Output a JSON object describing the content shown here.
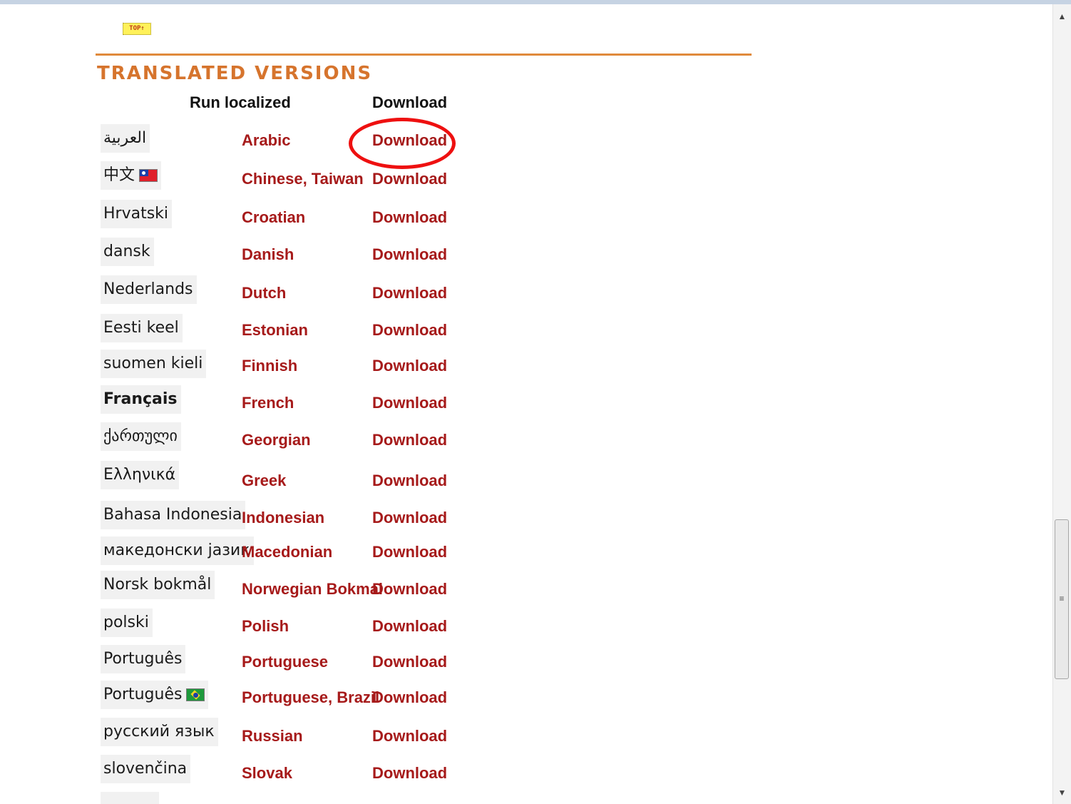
{
  "top_link": {
    "label": "TOP",
    "arrow": "↑"
  },
  "section": {
    "title": "TRANSLATED VERSIONS"
  },
  "headers": {
    "run_localized": "Run localized",
    "download": "Download"
  },
  "languages": [
    {
      "native": "العربية",
      "english": "Arabic",
      "download": "Download",
      "highlighted": true
    },
    {
      "native": "中文",
      "flag": "taiwan-flag-icon",
      "english": "Chinese, Taiwan",
      "download": "Download"
    },
    {
      "native": "Hrvatski",
      "english": "Croatian",
      "download": "Download"
    },
    {
      "native": "dansk",
      "english": "Danish",
      "download": "Download"
    },
    {
      "native": "Nederlands",
      "english": "Dutch",
      "download": "Download"
    },
    {
      "native": "Eesti keel",
      "english": "Estonian",
      "download": "Download"
    },
    {
      "native": "suomen kieli",
      "english": "Finnish",
      "download": "Download"
    },
    {
      "native": "Français",
      "english": "French",
      "download": "Download"
    },
    {
      "native": "ქართული",
      "english": "Georgian",
      "download": "Download"
    },
    {
      "native": "Ελληνικά",
      "english": "Greek",
      "download": "Download"
    },
    {
      "native": "Bahasa Indonesia",
      "english": "Indonesian",
      "download": "Download"
    },
    {
      "native": "македонски јазик",
      "english": "Macedonian",
      "download": "Download"
    },
    {
      "native": "Norsk bokmål",
      "english": "Norwegian Bokmal",
      "download": "Download"
    },
    {
      "native": "polski",
      "english": "Polish",
      "download": "Download"
    },
    {
      "native": "Português",
      "english": "Portuguese",
      "download": "Download"
    },
    {
      "native": "Português",
      "flag": "brazil-flag-icon",
      "english": "Portuguese, Brazil",
      "download": "Download"
    },
    {
      "native": "русский язык",
      "english": "Russian",
      "download": "Download"
    },
    {
      "native": "slovenčina",
      "english": "Slovak",
      "download": "Download"
    }
  ],
  "colors": {
    "link": "#a61a1a",
    "section_title": "#d6742d",
    "divider": "#e08a3c",
    "highlight_ring": "#ee1010"
  },
  "scrollbar": {
    "up_icon": "scroll-up-arrow-icon",
    "down_icon": "scroll-down-arrow-icon"
  }
}
